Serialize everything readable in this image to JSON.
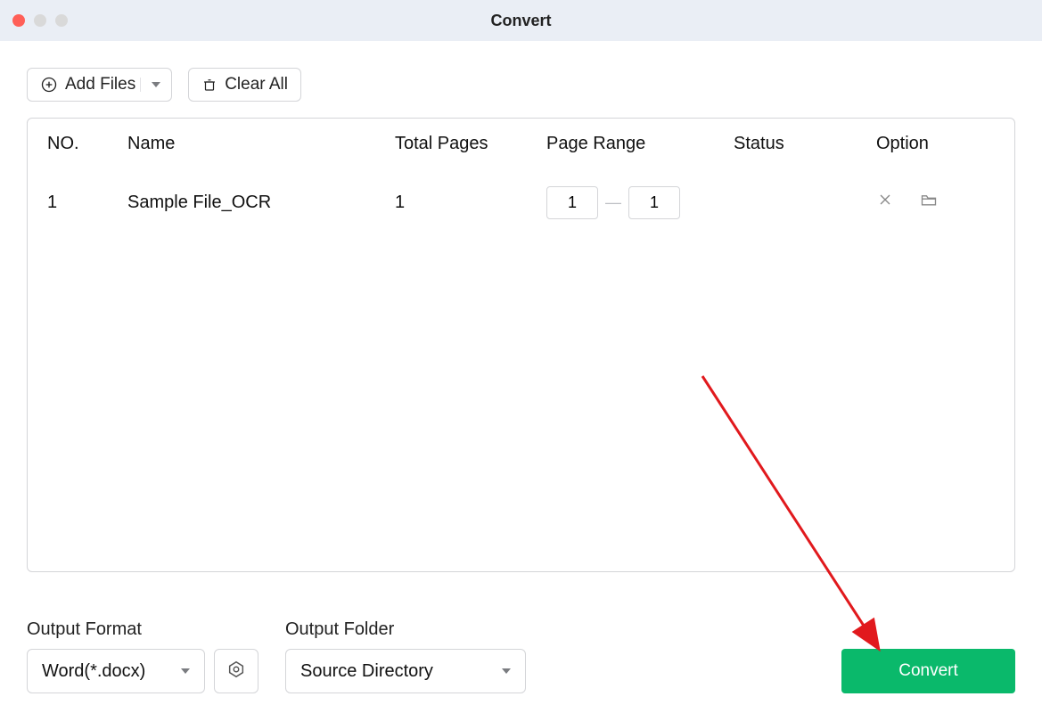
{
  "window": {
    "title": "Convert"
  },
  "toolbar": {
    "add_files_label": "Add Files",
    "clear_all_label": "Clear All"
  },
  "table": {
    "headers": {
      "no": "NO.",
      "name": "Name",
      "total_pages": "Total Pages",
      "page_range": "Page Range",
      "status": "Status",
      "option": "Option"
    },
    "rows": [
      {
        "no": "1",
        "name": "Sample File_OCR",
        "total_pages": "1",
        "page_from": "1",
        "page_to": "1",
        "status": ""
      }
    ]
  },
  "footer": {
    "output_format_label": "Output Format",
    "output_format_value": "Word(*.docx)",
    "output_folder_label": "Output Folder",
    "output_folder_value": "Source Directory",
    "convert_label": "Convert"
  }
}
